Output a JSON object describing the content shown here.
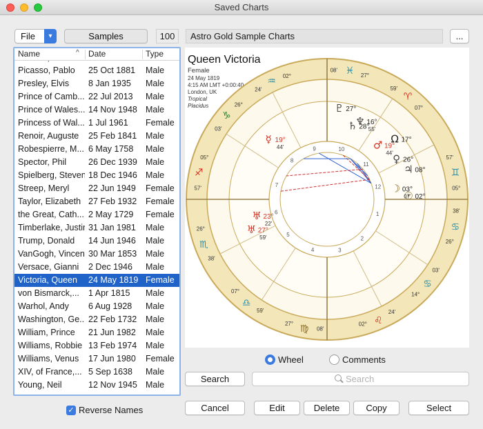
{
  "window": {
    "title": "Saved Charts"
  },
  "toolbar": {
    "file_label": "File",
    "samples_label": "Samples",
    "count": "100",
    "collection_name": "Astro Gold Sample Charts",
    "more_label": "..."
  },
  "list": {
    "columns": [
      "Name",
      "Date",
      "Type"
    ],
    "partial_top": {
      "name": "Pasteur, Louis",
      "date": "27 Dec 1822",
      "type": "Male"
    },
    "rows": [
      {
        "name": "Picasso, Pablo",
        "date": "25 Oct 1881",
        "type": "Male"
      },
      {
        "name": "Presley, Elvis",
        "date": "8 Jan 1935",
        "type": "Male"
      },
      {
        "name": "Prince of Camb...",
        "date": "22 Jul 2013",
        "type": "Male"
      },
      {
        "name": "Prince of Wales...",
        "date": "14 Nov 1948",
        "type": "Male"
      },
      {
        "name": "Princess of Wal...",
        "date": "1 Jul 1961",
        "type": "Female"
      },
      {
        "name": "Renoir, Auguste",
        "date": "25 Feb 1841",
        "type": "Male"
      },
      {
        "name": "Robespierre, M...",
        "date": "6 May 1758",
        "type": "Male"
      },
      {
        "name": "Spector, Phil",
        "date": "26 Dec 1939",
        "type": "Male"
      },
      {
        "name": "Spielberg, Steven",
        "date": "18 Dec 1946",
        "type": "Male"
      },
      {
        "name": "Streep, Meryl",
        "date": "22 Jun 1949",
        "type": "Female"
      },
      {
        "name": "Taylor, Elizabeth",
        "date": "27 Feb 1932",
        "type": "Female"
      },
      {
        "name": "the Great, Cath...",
        "date": "2 May 1729",
        "type": "Female"
      },
      {
        "name": "Timberlake, Justin",
        "date": "31 Jan 1981",
        "type": "Male"
      },
      {
        "name": "Trump, Donald",
        "date": "14 Jun 1946",
        "type": "Male"
      },
      {
        "name": "VanGogh, Vincent",
        "date": "30 Mar 1853",
        "type": "Male"
      },
      {
        "name": "Versace, Gianni",
        "date": "2 Dec 1946",
        "type": "Male"
      },
      {
        "name": "Victoria, Queen",
        "date": "24 May 1819",
        "type": "Female",
        "selected": true
      },
      {
        "name": "von Bismarck,...",
        "date": "1 Apr 1815",
        "type": "Male"
      },
      {
        "name": "Warhol, Andy",
        "date": "6 Aug 1928",
        "type": "Male"
      },
      {
        "name": "Washington, Ge...",
        "date": "22 Feb 1732",
        "type": "Male"
      },
      {
        "name": "William, Prince",
        "date": "21 Jun 1982",
        "type": "Male"
      },
      {
        "name": "Williams, Robbie",
        "date": "13 Feb 1974",
        "type": "Male"
      },
      {
        "name": "Williams, Venus",
        "date": "17 Jun 1980",
        "type": "Female"
      },
      {
        "name": "XIV, of France,...",
        "date": "5 Sep 1638",
        "type": "Male"
      },
      {
        "name": "Young, Neil",
        "date": "12 Nov 1945",
        "type": "Male"
      }
    ],
    "reverse_names_label": "Reverse Names"
  },
  "chart": {
    "name": "Queen Victoria",
    "details": [
      "Female",
      "24 May 1819",
      "4:15 AM LMT +0:00:40",
      "London, UK",
      "Tropical",
      "Placidus"
    ],
    "house_numbers": [
      "1",
      "2",
      "3",
      "4",
      "5",
      "6",
      "7",
      "8",
      "9",
      "10",
      "11",
      "12"
    ],
    "cusp_labels": [
      {
        "deg": "27°",
        "min": "08'",
        "sign": "♓",
        "color": "#2a8fa8"
      },
      {
        "deg": "02°",
        "min": "24'",
        "sign": "♒",
        "color": "#2a8fa8"
      },
      {
        "deg": "26°",
        "min": "03'",
        "sign": "♑",
        "color": "#2e7a2e"
      },
      {
        "deg": "05°",
        "min": "57'",
        "sign": "♐",
        "color": "#d83020"
      },
      {
        "deg": "26°",
        "min": "38'",
        "sign": "♏",
        "color": "#2a8fa8"
      },
      {
        "deg": "07°",
        "min": "59'",
        "sign": "♎",
        "color": "#2a8fa8"
      },
      {
        "deg": "27°",
        "min": "08'",
        "sign": "♍",
        "color": "#8a6a20"
      },
      {
        "deg": "02°",
        "min": "24'",
        "sign": "♌",
        "color": "#d83020"
      },
      {
        "deg": "14°",
        "min": "03'",
        "sign": "♋",
        "color": "#2a8fa8"
      },
      {
        "deg": "26°",
        "min": "38'",
        "sign": "♋",
        "color": "#2a8fa8"
      },
      {
        "deg": "05°",
        "min": "57'",
        "sign": "♊",
        "color": "#2a8fa8"
      },
      {
        "deg": "07°",
        "min": "59'",
        "sign": "♈",
        "color": "#d83020"
      }
    ],
    "planet_labels": [
      {
        "glyph": "♆",
        "text": "16°",
        "sub": "55'",
        "color": "#444"
      },
      {
        "glyph": "♇",
        "text": "27°",
        "sub": "",
        "color": "#444"
      },
      {
        "glyph": "♄",
        "text": "28°",
        "sub": "",
        "color": "#444"
      },
      {
        "glyph": "Ω",
        "text": "17°",
        "sub": "",
        "color": "#222"
      },
      {
        "glyph": "♀",
        "text": "26°",
        "sub": "",
        "color": "#444"
      },
      {
        "glyph": "♂",
        "text": "19°",
        "sub": "44'",
        "color": "#d83020"
      },
      {
        "glyph": "♃",
        "text": "08°",
        "sub": "",
        "color": "#444"
      },
      {
        "glyph": "☉",
        "text": "02°",
        "sub": "",
        "color": "#8a6a20"
      },
      {
        "glyph": "☽",
        "text": "03°",
        "sub": "07'",
        "color": "#8a6a20"
      },
      {
        "glyph": "♅",
        "text": "27°",
        "sub": "59'",
        "color": "#d83020"
      },
      {
        "glyph": "♅",
        "text": "23°",
        "sub": "22'",
        "color": "#d83020"
      },
      {
        "glyph": "☿",
        "text": "19°",
        "sub": "44'",
        "color": "#d83020"
      }
    ]
  },
  "view": {
    "wheel_label": "Wheel",
    "comments_label": "Comments",
    "selected": "Wheel"
  },
  "search": {
    "button_label": "Search",
    "placeholder": "Search"
  },
  "actions": {
    "cancel": "Cancel",
    "edit": "Edit",
    "delete": "Delete",
    "copy": "Copy",
    "select": "Select"
  },
  "colors": {
    "selection": "#1f62c8",
    "accent": "#3b7be0",
    "zodiac_ring": "#f3e6b8",
    "ring_border": "#d4b868"
  }
}
